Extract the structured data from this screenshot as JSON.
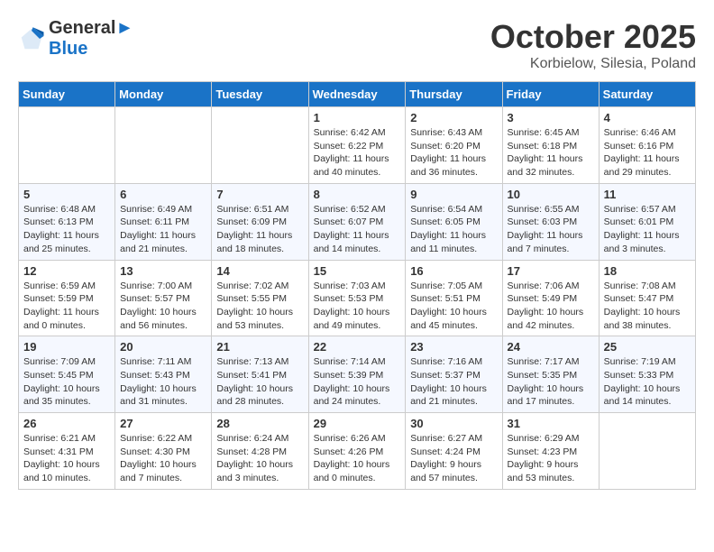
{
  "header": {
    "logo_line1": "General",
    "logo_line2": "Blue",
    "month": "October 2025",
    "location": "Korbielow, Silesia, Poland"
  },
  "days_of_week": [
    "Sunday",
    "Monday",
    "Tuesday",
    "Wednesday",
    "Thursday",
    "Friday",
    "Saturday"
  ],
  "weeks": [
    [
      {
        "day": "",
        "info": ""
      },
      {
        "day": "",
        "info": ""
      },
      {
        "day": "",
        "info": ""
      },
      {
        "day": "1",
        "info": "Sunrise: 6:42 AM\nSunset: 6:22 PM\nDaylight: 11 hours\nand 40 minutes."
      },
      {
        "day": "2",
        "info": "Sunrise: 6:43 AM\nSunset: 6:20 PM\nDaylight: 11 hours\nand 36 minutes."
      },
      {
        "day": "3",
        "info": "Sunrise: 6:45 AM\nSunset: 6:18 PM\nDaylight: 11 hours\nand 32 minutes."
      },
      {
        "day": "4",
        "info": "Sunrise: 6:46 AM\nSunset: 6:16 PM\nDaylight: 11 hours\nand 29 minutes."
      }
    ],
    [
      {
        "day": "5",
        "info": "Sunrise: 6:48 AM\nSunset: 6:13 PM\nDaylight: 11 hours\nand 25 minutes."
      },
      {
        "day": "6",
        "info": "Sunrise: 6:49 AM\nSunset: 6:11 PM\nDaylight: 11 hours\nand 21 minutes."
      },
      {
        "day": "7",
        "info": "Sunrise: 6:51 AM\nSunset: 6:09 PM\nDaylight: 11 hours\nand 18 minutes."
      },
      {
        "day": "8",
        "info": "Sunrise: 6:52 AM\nSunset: 6:07 PM\nDaylight: 11 hours\nand 14 minutes."
      },
      {
        "day": "9",
        "info": "Sunrise: 6:54 AM\nSunset: 6:05 PM\nDaylight: 11 hours\nand 11 minutes."
      },
      {
        "day": "10",
        "info": "Sunrise: 6:55 AM\nSunset: 6:03 PM\nDaylight: 11 hours\nand 7 minutes."
      },
      {
        "day": "11",
        "info": "Sunrise: 6:57 AM\nSunset: 6:01 PM\nDaylight: 11 hours\nand 3 minutes."
      }
    ],
    [
      {
        "day": "12",
        "info": "Sunrise: 6:59 AM\nSunset: 5:59 PM\nDaylight: 11 hours\nand 0 minutes."
      },
      {
        "day": "13",
        "info": "Sunrise: 7:00 AM\nSunset: 5:57 PM\nDaylight: 10 hours\nand 56 minutes."
      },
      {
        "day": "14",
        "info": "Sunrise: 7:02 AM\nSunset: 5:55 PM\nDaylight: 10 hours\nand 53 minutes."
      },
      {
        "day": "15",
        "info": "Sunrise: 7:03 AM\nSunset: 5:53 PM\nDaylight: 10 hours\nand 49 minutes."
      },
      {
        "day": "16",
        "info": "Sunrise: 7:05 AM\nSunset: 5:51 PM\nDaylight: 10 hours\nand 45 minutes."
      },
      {
        "day": "17",
        "info": "Sunrise: 7:06 AM\nSunset: 5:49 PM\nDaylight: 10 hours\nand 42 minutes."
      },
      {
        "day": "18",
        "info": "Sunrise: 7:08 AM\nSunset: 5:47 PM\nDaylight: 10 hours\nand 38 minutes."
      }
    ],
    [
      {
        "day": "19",
        "info": "Sunrise: 7:09 AM\nSunset: 5:45 PM\nDaylight: 10 hours\nand 35 minutes."
      },
      {
        "day": "20",
        "info": "Sunrise: 7:11 AM\nSunset: 5:43 PM\nDaylight: 10 hours\nand 31 minutes."
      },
      {
        "day": "21",
        "info": "Sunrise: 7:13 AM\nSunset: 5:41 PM\nDaylight: 10 hours\nand 28 minutes."
      },
      {
        "day": "22",
        "info": "Sunrise: 7:14 AM\nSunset: 5:39 PM\nDaylight: 10 hours\nand 24 minutes."
      },
      {
        "day": "23",
        "info": "Sunrise: 7:16 AM\nSunset: 5:37 PM\nDaylight: 10 hours\nand 21 minutes."
      },
      {
        "day": "24",
        "info": "Sunrise: 7:17 AM\nSunset: 5:35 PM\nDaylight: 10 hours\nand 17 minutes."
      },
      {
        "day": "25",
        "info": "Sunrise: 7:19 AM\nSunset: 5:33 PM\nDaylight: 10 hours\nand 14 minutes."
      }
    ],
    [
      {
        "day": "26",
        "info": "Sunrise: 6:21 AM\nSunset: 4:31 PM\nDaylight: 10 hours\nand 10 minutes."
      },
      {
        "day": "27",
        "info": "Sunrise: 6:22 AM\nSunset: 4:30 PM\nDaylight: 10 hours\nand 7 minutes."
      },
      {
        "day": "28",
        "info": "Sunrise: 6:24 AM\nSunset: 4:28 PM\nDaylight: 10 hours\nand 3 minutes."
      },
      {
        "day": "29",
        "info": "Sunrise: 6:26 AM\nSunset: 4:26 PM\nDaylight: 10 hours\nand 0 minutes."
      },
      {
        "day": "30",
        "info": "Sunrise: 6:27 AM\nSunset: 4:24 PM\nDaylight: 9 hours\nand 57 minutes."
      },
      {
        "day": "31",
        "info": "Sunrise: 6:29 AM\nSunset: 4:23 PM\nDaylight: 9 hours\nand 53 minutes."
      },
      {
        "day": "",
        "info": ""
      }
    ]
  ]
}
